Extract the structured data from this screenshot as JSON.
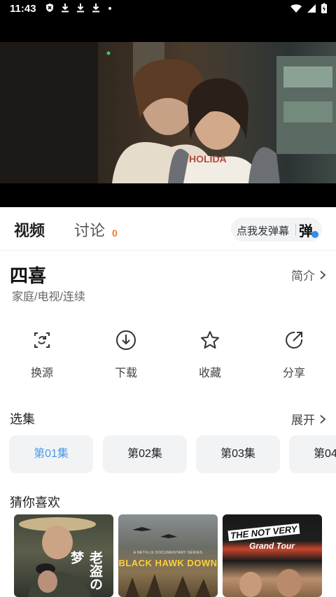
{
  "status_bar": {
    "time": "11:43",
    "icons_left": [
      "shield-close-icon",
      "download-icon",
      "download-icon",
      "download-icon",
      "dot-icon"
    ],
    "icons_right": [
      "wifi-icon",
      "signal-icon",
      "battery-icon"
    ]
  },
  "player": {
    "content": "video-frame"
  },
  "tabs": {
    "video_label": "视频",
    "discuss_label": "讨论",
    "discuss_count": "0",
    "danmu_placeholder": "点我发弹幕",
    "danmu_button": "弹"
  },
  "show": {
    "title": "四喜",
    "genre": "家庭/电视/连续",
    "intro_label": "简介"
  },
  "actions": [
    {
      "label": "换源",
      "icon": "switch-source-icon"
    },
    {
      "label": "下载",
      "icon": "download-icon"
    },
    {
      "label": "收藏",
      "icon": "star-icon"
    },
    {
      "label": "分享",
      "icon": "share-icon"
    }
  ],
  "episodes": {
    "title": "选集",
    "expand_label": "展开",
    "items": [
      "第01集",
      "第02集",
      "第03集",
      "第04"
    ],
    "selected_index": 0,
    "accent_color": "#4a9ae6"
  },
  "recommendations": {
    "title": "猜你喜欢",
    "posters": [
      {
        "text": "老盗の梦"
      },
      {
        "small_text": "A NETFLIX DOCUMENTARY SERIES",
        "text": "BLACK HAWK DOWN"
      },
      {
        "text_a": "THE NOT VERY",
        "text_b": "Grand Tour"
      }
    ]
  },
  "colors": {
    "count_badge": "#f07a26",
    "verified_badge": "#2f8cf5"
  }
}
